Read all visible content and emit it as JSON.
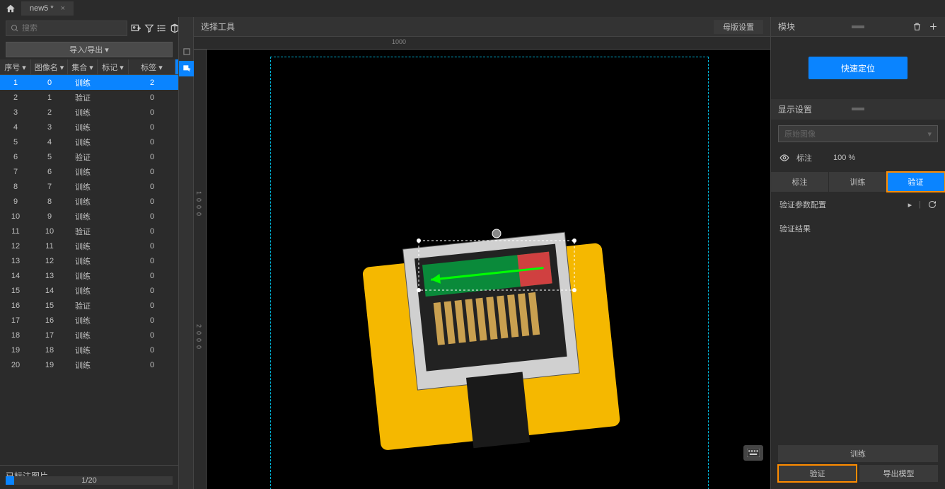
{
  "tab": {
    "title": "new5 *"
  },
  "search": {
    "placeholder": "搜索"
  },
  "importExport": {
    "label": "导入/导出 ▾"
  },
  "table": {
    "headers": {
      "c1": "序号 ▾",
      "c2": "图像名 ▾",
      "c3": "集合 ▾",
      "c4": "标记 ▾",
      "c5": "标签 ▾"
    },
    "rows": [
      {
        "id": "1",
        "name": "0",
        "set": "训练",
        "mark": "",
        "tag": "2",
        "selected": true
      },
      {
        "id": "2",
        "name": "1",
        "set": "验证",
        "mark": "",
        "tag": "0"
      },
      {
        "id": "3",
        "name": "2",
        "set": "训练",
        "mark": "",
        "tag": "0"
      },
      {
        "id": "4",
        "name": "3",
        "set": "训练",
        "mark": "",
        "tag": "0"
      },
      {
        "id": "5",
        "name": "4",
        "set": "训练",
        "mark": "",
        "tag": "0"
      },
      {
        "id": "6",
        "name": "5",
        "set": "验证",
        "mark": "",
        "tag": "0"
      },
      {
        "id": "7",
        "name": "6",
        "set": "训练",
        "mark": "",
        "tag": "0"
      },
      {
        "id": "8",
        "name": "7",
        "set": "训练",
        "mark": "",
        "tag": "0"
      },
      {
        "id": "9",
        "name": "8",
        "set": "训练",
        "mark": "",
        "tag": "0"
      },
      {
        "id": "10",
        "name": "9",
        "set": "训练",
        "mark": "",
        "tag": "0"
      },
      {
        "id": "11",
        "name": "10",
        "set": "验证",
        "mark": "",
        "tag": "0"
      },
      {
        "id": "12",
        "name": "11",
        "set": "训练",
        "mark": "",
        "tag": "0"
      },
      {
        "id": "13",
        "name": "12",
        "set": "训练",
        "mark": "",
        "tag": "0"
      },
      {
        "id": "14",
        "name": "13",
        "set": "训练",
        "mark": "",
        "tag": "0"
      },
      {
        "id": "15",
        "name": "14",
        "set": "训练",
        "mark": "",
        "tag": "0"
      },
      {
        "id": "16",
        "name": "15",
        "set": "验证",
        "mark": "",
        "tag": "0"
      },
      {
        "id": "17",
        "name": "16",
        "set": "训练",
        "mark": "",
        "tag": "0"
      },
      {
        "id": "18",
        "name": "17",
        "set": "训练",
        "mark": "",
        "tag": "0"
      },
      {
        "id": "19",
        "name": "18",
        "set": "训练",
        "mark": "",
        "tag": "0"
      },
      {
        "id": "20",
        "name": "19",
        "set": "训练",
        "mark": "",
        "tag": "0"
      }
    ]
  },
  "footer": {
    "label": "已标注图片",
    "counter": "1/20"
  },
  "canvas": {
    "toolLabel": "选择工具",
    "settingsBtn": "母版设置"
  },
  "ruler": {
    "h1": "1000",
    "v1": "1",
    "v2": "0",
    "v3": "0",
    "v4": "0",
    "v5": "2",
    "v6": "0",
    "v7": "0",
    "v8": "0"
  },
  "right": {
    "title": "模块",
    "quickLoc": "快速定位",
    "displaySettings": "显示设置",
    "dropdown": "原始图像",
    "annotation": "标注",
    "percent": "100 %",
    "tabs": {
      "annot": "标注",
      "train": "训练",
      "verify": "验证"
    },
    "verifyConfig": "验证参数配置",
    "verifyResult": "验证结果",
    "trainBtn": "训练",
    "verifyBtn": "验证",
    "exportBtn": "导出模型"
  }
}
